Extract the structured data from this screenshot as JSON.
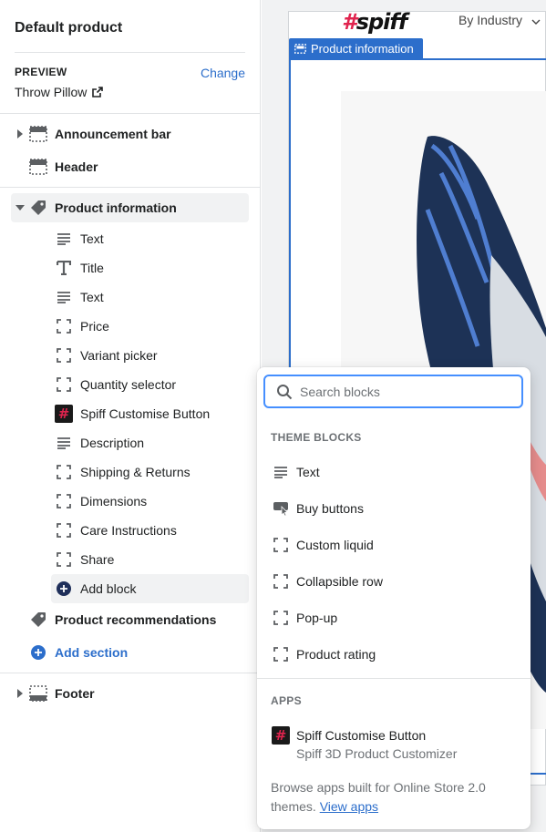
{
  "sidebar": {
    "title": "Default product",
    "preview": {
      "label": "PREVIEW",
      "change": "Change",
      "value": "Throw Pillow"
    },
    "sections": {
      "announcement": "Announcement bar",
      "header": "Header",
      "product_information": "Product information",
      "product_recommendations": "Product recommendations",
      "add_section": "Add section",
      "footer": "Footer"
    },
    "blocks": [
      {
        "label": "Text",
        "icon": "text-icon"
      },
      {
        "label": "Title",
        "icon": "title-icon"
      },
      {
        "label": "Text",
        "icon": "text-icon"
      },
      {
        "label": "Price",
        "icon": "dashed-square-icon"
      },
      {
        "label": "Variant picker",
        "icon": "dashed-square-icon"
      },
      {
        "label": "Quantity selector",
        "icon": "dashed-square-icon"
      },
      {
        "label": "Spiff Customise Button",
        "icon": "spiff-app-icon"
      },
      {
        "label": "Description",
        "icon": "text-icon"
      },
      {
        "label": "Shipping & Returns",
        "icon": "dashed-square-icon"
      },
      {
        "label": "Dimensions",
        "icon": "dashed-square-icon"
      },
      {
        "label": "Care Instructions",
        "icon": "dashed-square-icon"
      },
      {
        "label": "Share",
        "icon": "dashed-square-icon"
      }
    ],
    "add_block": "Add block"
  },
  "preview_area": {
    "logo": "#spiff",
    "nav_item": "By Industry",
    "section_tag": "Product information"
  },
  "popover": {
    "search": {
      "placeholder": "Search blocks",
      "value": ""
    },
    "theme_heading": "THEME BLOCKS",
    "theme_blocks": [
      {
        "label": "Text",
        "icon": "text-icon"
      },
      {
        "label": "Buy buttons",
        "icon": "buy-buttons-icon"
      },
      {
        "label": "Custom liquid",
        "icon": "dashed-square-icon"
      },
      {
        "label": "Collapsible row",
        "icon": "dashed-square-icon"
      },
      {
        "label": "Pop-up",
        "icon": "dashed-square-icon"
      },
      {
        "label": "Product rating",
        "icon": "dashed-square-icon"
      }
    ],
    "apps_heading": "APPS",
    "app": {
      "name": "Spiff Customise Button",
      "description": "Spiff 3D Product Customizer"
    },
    "browse_text": "Browse apps built for Online Store 2.0 themes.",
    "browse_link": "View apps"
  },
  "colors": {
    "accent": "#2c6ecb",
    "focus": "#458fff",
    "spiff_red": "#e0234e"
  }
}
